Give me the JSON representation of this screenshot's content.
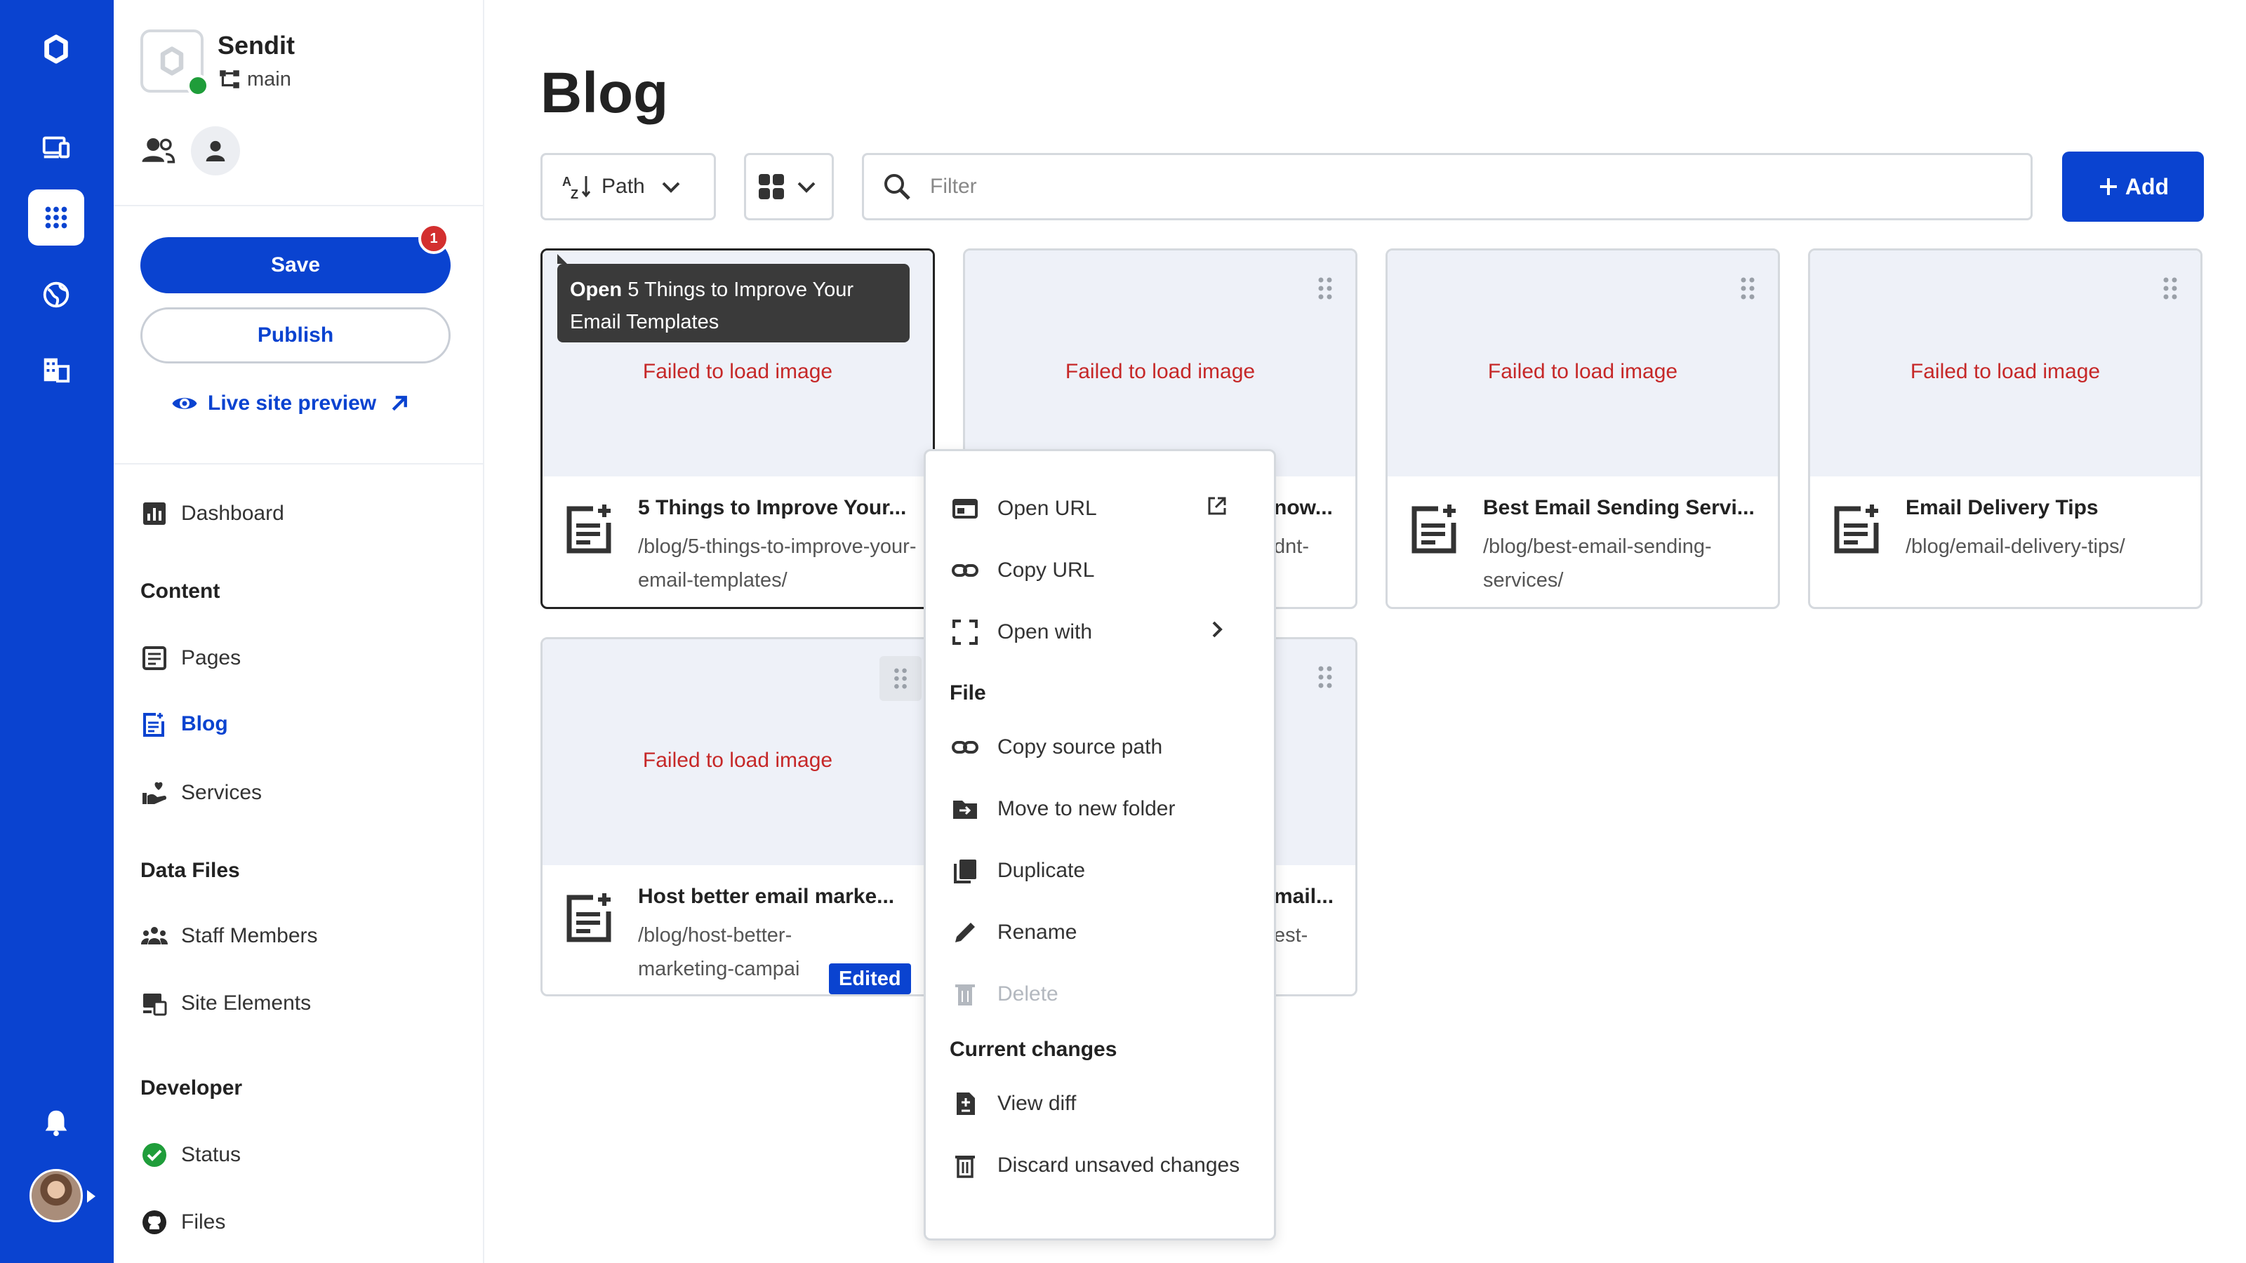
{
  "colors": {
    "brand": "#0a43d0",
    "danger": "#c62828",
    "success": "#1f9d3a"
  },
  "site": {
    "name": "Sendit",
    "branch": "main"
  },
  "panel": {
    "save_label": "Save",
    "save_badge": "1",
    "publish_label": "Publish",
    "live_preview_label": "Live site preview"
  },
  "nav": {
    "dashboard": "Dashboard",
    "content_heading": "Content",
    "pages": "Pages",
    "blog": "Blog",
    "services": "Services",
    "data_files_heading": "Data Files",
    "staff_members": "Staff Members",
    "site_elements": "Site Elements",
    "developer_heading": "Developer",
    "status": "Status",
    "files": "Files"
  },
  "main": {
    "title": "Blog",
    "sort_label": "Path",
    "filter_placeholder": "Filter",
    "add_label": "Add"
  },
  "cards": [
    {
      "title": "5 Things to Improve Your...",
      "path": "/blog/5-things-to-improve-your-email-templates/",
      "image_error": "Failed to load image"
    },
    {
      "title": "now...",
      "path": "dnt-",
      "image_error": "Failed to load image"
    },
    {
      "title": "Best Email Sending Servi...",
      "path": "/blog/best-email-sending-services/",
      "image_error": "Failed to load image"
    },
    {
      "title": "Email Delivery Tips",
      "path": "/blog/email-delivery-tips/",
      "image_error": "Failed to load image"
    },
    {
      "title": "Host better email marke...",
      "path": "/blog/host-better-marketing-campai",
      "image_error": "Failed to load image",
      "badge": "Edited"
    },
    {
      "title": "mail...",
      "path": "est-"
    }
  ],
  "tooltip": {
    "action": "Open",
    "text": "5 Things to Improve Your Email Templates"
  },
  "context_menu": {
    "open_url": "Open URL",
    "copy_url": "Copy URL",
    "open_with": "Open with",
    "file_heading": "File",
    "copy_source_path": "Copy source path",
    "move_to_new_folder": "Move to new folder",
    "duplicate": "Duplicate",
    "rename": "Rename",
    "delete": "Delete",
    "current_changes_heading": "Current changes",
    "view_diff": "View diff",
    "discard_unsaved": "Discard unsaved changes"
  }
}
